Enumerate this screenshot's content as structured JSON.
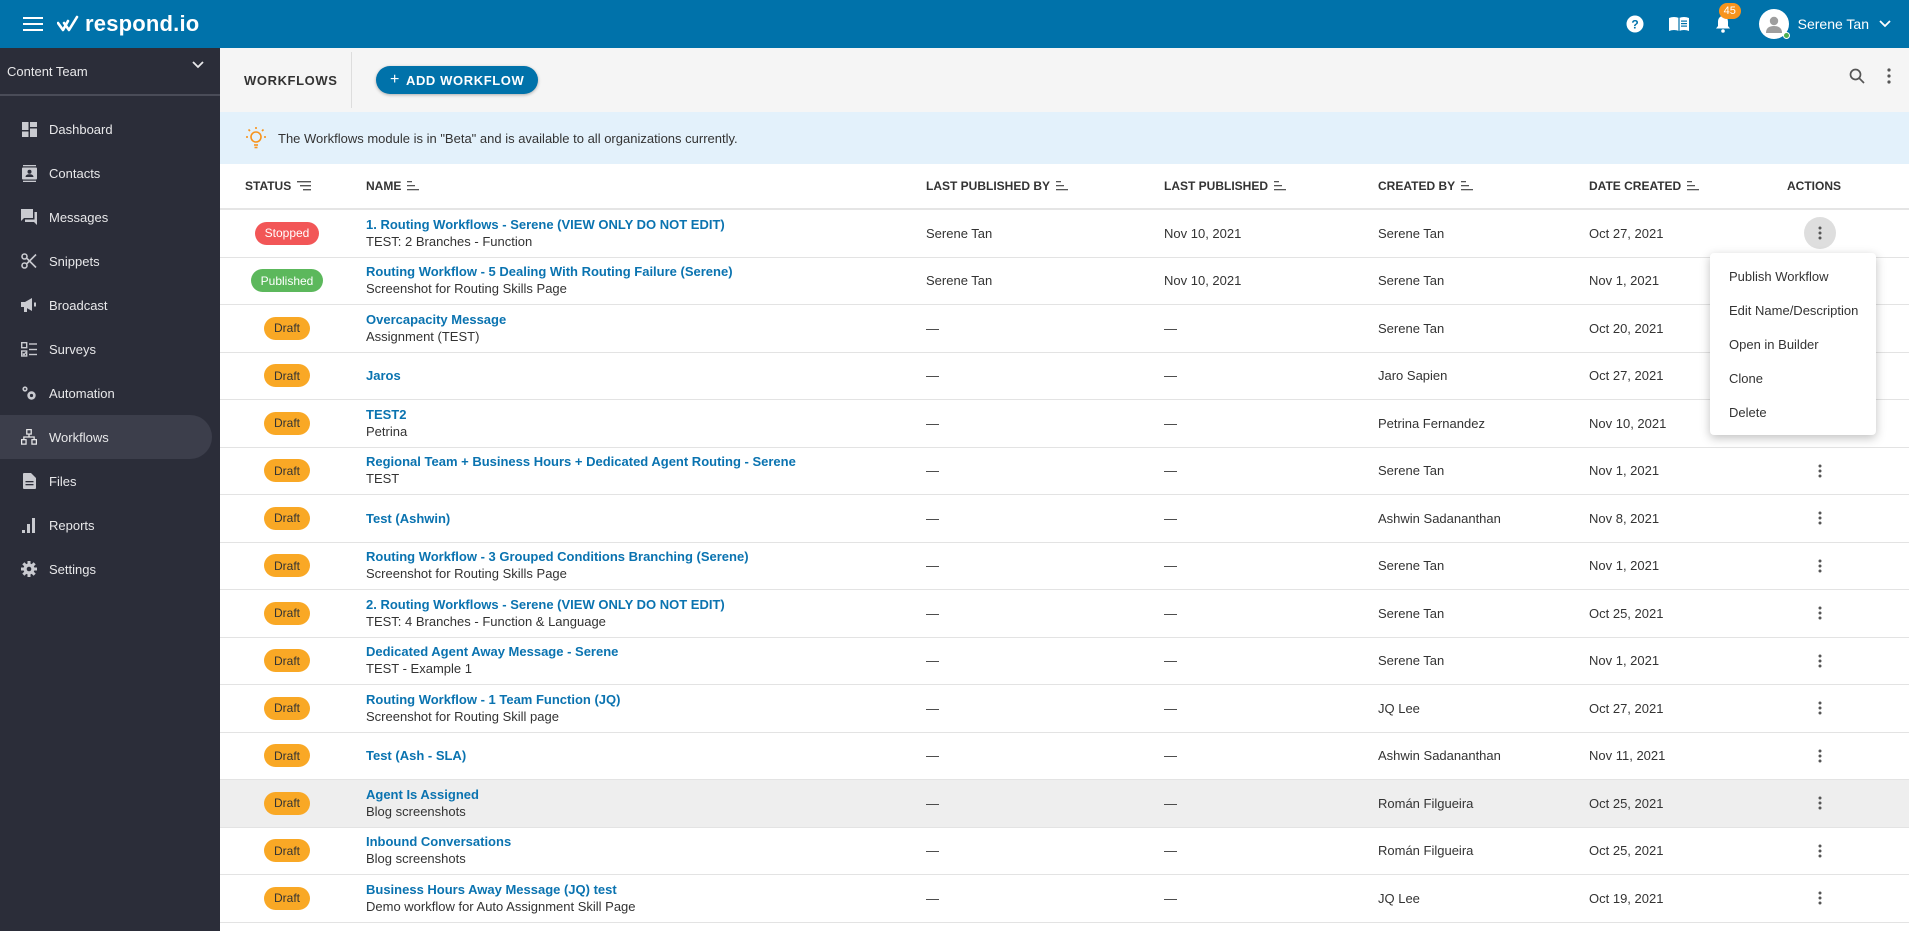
{
  "topbar": {
    "brand": "respond.io",
    "notification_count": "45",
    "user_name": "Serene Tan",
    "brand_color": "#0072aa"
  },
  "sidebar": {
    "team": "Content Team",
    "items": [
      {
        "label": "Dashboard",
        "icon": "dashboard-icon"
      },
      {
        "label": "Contacts",
        "icon": "contacts-icon"
      },
      {
        "label": "Messages",
        "icon": "messages-icon"
      },
      {
        "label": "Snippets",
        "icon": "scissors-icon"
      },
      {
        "label": "Broadcast",
        "icon": "megaphone-icon"
      },
      {
        "label": "Surveys",
        "icon": "checklist-icon"
      },
      {
        "label": "Automation",
        "icon": "gears-icon"
      },
      {
        "label": "Workflows",
        "icon": "hierarchy-icon",
        "active": true
      },
      {
        "label": "Files",
        "icon": "file-icon"
      },
      {
        "label": "Reports",
        "icon": "bar-chart-icon"
      },
      {
        "label": "Settings",
        "icon": "gear-icon"
      }
    ]
  },
  "toolbar": {
    "title": "WORKFLOWS",
    "add_label": "ADD WORKFLOW"
  },
  "banner": {
    "text": "The Workflows module is in \"Beta\" and is available to all organizations currently."
  },
  "table": {
    "headers": {
      "status": "STATUS",
      "name": "NAME",
      "last_published_by": "LAST PUBLISHED BY",
      "last_published": "LAST PUBLISHED",
      "created_by": "CREATED BY",
      "date_created": "DATE CREATED",
      "actions": "ACTIONS"
    },
    "rows": [
      {
        "status": "Stopped",
        "kind": "stopped",
        "name": "1. Routing Workflows - Serene (VIEW ONLY DO NOT EDIT)",
        "desc": "TEST: 2 Branches - Function",
        "lpb": "Serene Tan",
        "lp": "Nov 10, 2021",
        "cb": "Serene Tan",
        "dc": "Oct 27, 2021"
      },
      {
        "status": "Published",
        "kind": "published",
        "name": "Routing Workflow - 5 Dealing With Routing Failure (Serene)",
        "desc": "Screenshot for Routing Skills Page",
        "lpb": "Serene Tan",
        "lp": "Nov 10, 2021",
        "cb": "Serene Tan",
        "dc": "Nov 1, 2021"
      },
      {
        "status": "Draft",
        "kind": "draft",
        "name": "Overcapacity Message",
        "desc": "Assignment (TEST)",
        "lpb": "—",
        "lp": "—",
        "cb": "Serene Tan",
        "dc": "Oct 20, 2021"
      },
      {
        "status": "Draft",
        "kind": "draft",
        "name": "Jaros",
        "desc": "",
        "lpb": "—",
        "lp": "—",
        "cb": "Jaro Sapien",
        "dc": "Oct 27, 2021"
      },
      {
        "status": "Draft",
        "kind": "draft",
        "name": "TEST2",
        "desc": "Petrina",
        "lpb": "—",
        "lp": "—",
        "cb": "Petrina Fernandez",
        "dc": "Nov 10, 2021"
      },
      {
        "status": "Draft",
        "kind": "draft",
        "name": "Regional Team + Business Hours + Dedicated Agent Routing - Serene",
        "desc": "TEST",
        "lpb": "—",
        "lp": "—",
        "cb": "Serene Tan",
        "dc": "Nov 1, 2021"
      },
      {
        "status": "Draft",
        "kind": "draft",
        "name": "Test (Ashwin)",
        "desc": "",
        "lpb": "—",
        "lp": "—",
        "cb": "Ashwin Sadananthan",
        "dc": "Nov 8, 2021"
      },
      {
        "status": "Draft",
        "kind": "draft",
        "name": "Routing Workflow - 3 Grouped Conditions Branching (Serene)",
        "desc": "Screenshot for Routing Skills Page",
        "lpb": "—",
        "lp": "—",
        "cb": "Serene Tan",
        "dc": "Nov 1, 2021"
      },
      {
        "status": "Draft",
        "kind": "draft",
        "name": "2. Routing Workflows - Serene (VIEW ONLY DO NOT EDIT)",
        "desc": "TEST: 4 Branches - Function & Language",
        "lpb": "—",
        "lp": "—",
        "cb": "Serene Tan",
        "dc": "Oct 25, 2021"
      },
      {
        "status": "Draft",
        "kind": "draft",
        "name": "Dedicated Agent Away Message - Serene",
        "desc": "TEST - Example 1",
        "lpb": "—",
        "lp": "—",
        "cb": "Serene Tan",
        "dc": "Nov 1, 2021"
      },
      {
        "status": "Draft",
        "kind": "draft",
        "name": "Routing Workflow - 1 Team Function (JQ)",
        "desc": "Screenshot for Routing Skill page",
        "lpb": "—",
        "lp": "—",
        "cb": "JQ Lee",
        "dc": "Oct 27, 2021"
      },
      {
        "status": "Draft",
        "kind": "draft",
        "name": "Test (Ash - SLA)",
        "desc": "",
        "lpb": "—",
        "lp": "—",
        "cb": "Ashwin Sadananthan",
        "dc": "Nov 11, 2021"
      },
      {
        "status": "Draft",
        "kind": "draft",
        "name": "Agent Is Assigned",
        "desc": "Blog screenshots",
        "lpb": "—",
        "lp": "—",
        "cb": "Román Filgueira",
        "dc": "Oct 25, 2021",
        "hover": true
      },
      {
        "status": "Draft",
        "kind": "draft",
        "name": "Inbound Conversations",
        "desc": "Blog screenshots",
        "lpb": "—",
        "lp": "—",
        "cb": "Román Filgueira",
        "dc": "Oct 25, 2021"
      },
      {
        "status": "Draft",
        "kind": "draft",
        "name": "Business Hours Away Message (JQ) test",
        "desc": "Demo workflow for Auto Assignment Skill Page",
        "lpb": "—",
        "lp": "—",
        "cb": "JQ Lee",
        "dc": "Oct 19, 2021"
      }
    ]
  },
  "actions_menu": {
    "items": [
      "Publish Workflow",
      "Edit Name/Description",
      "Open in Builder",
      "Clone",
      "Delete"
    ]
  },
  "colors": {
    "stopped": "#f25657",
    "published": "#5cb85c",
    "draft": "#f9a825",
    "link": "#0a73b0"
  }
}
